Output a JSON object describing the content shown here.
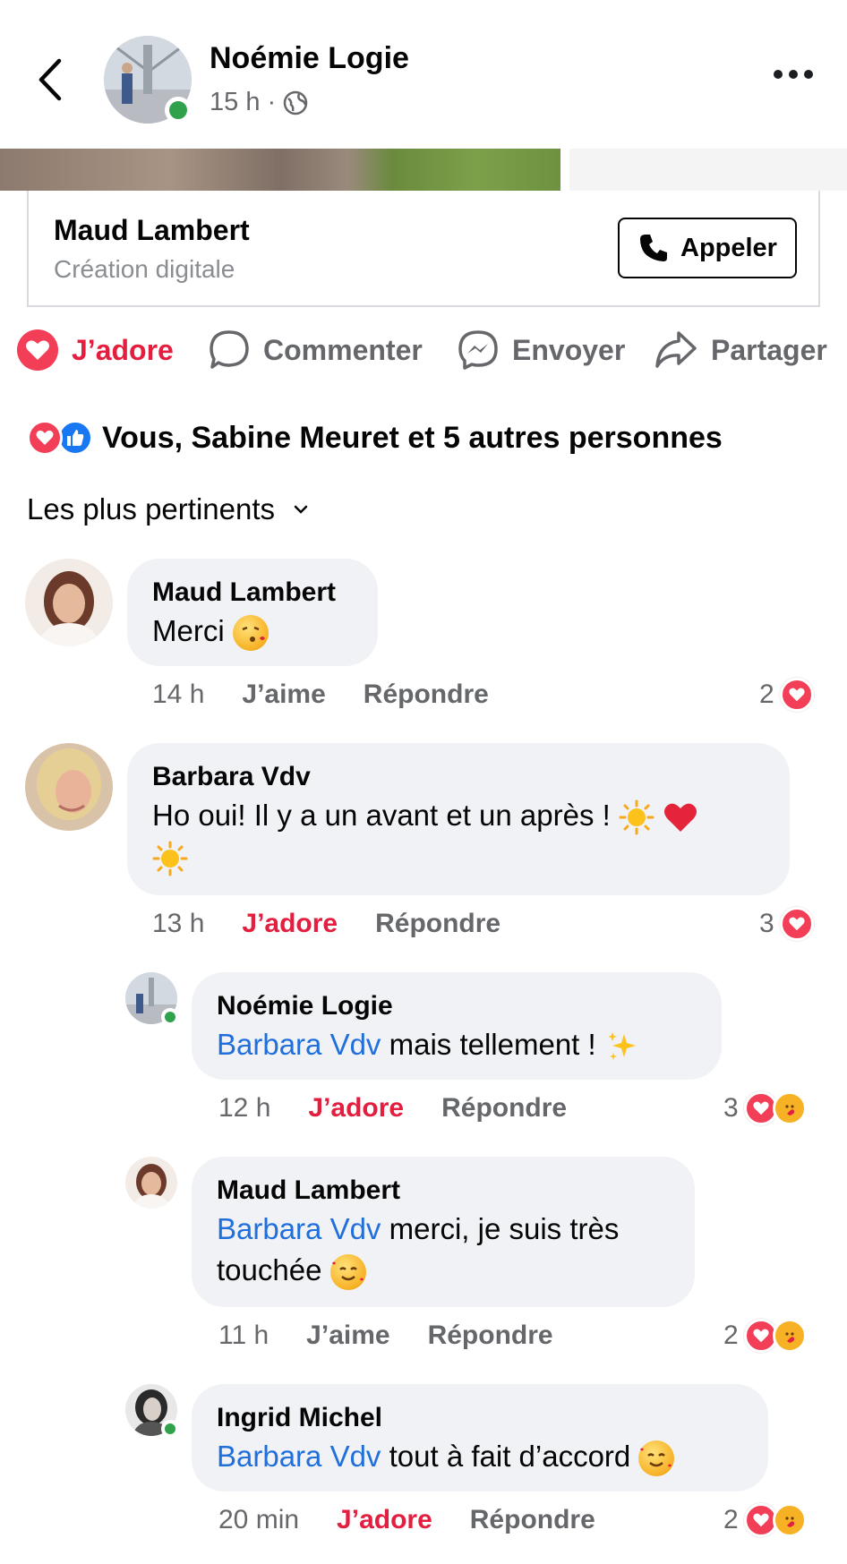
{
  "header": {
    "author": "Noémie Logie",
    "time": "15 h",
    "separator": "·",
    "icons": {
      "back": "chevron-left-icon",
      "privacy": "globe-icon",
      "more": "more-horizontal-icon"
    }
  },
  "business_card": {
    "name": "Maud Lambert",
    "subtitle": "Création digitale",
    "call_label": "Appeler",
    "call_icon": "phone-icon"
  },
  "actions": [
    {
      "label": "J’adore",
      "icon": "heart-icon",
      "active": true
    },
    {
      "label": "Commenter",
      "icon": "comment-icon",
      "active": false
    },
    {
      "label": "Envoyer",
      "icon": "messenger-icon",
      "active": false
    },
    {
      "label": "Partager",
      "icon": "share-icon",
      "active": false
    }
  ],
  "reactions_summary": {
    "text": "Vous, Sabine Meuret et 5 autres personnes",
    "icons": [
      "love-reaction-icon",
      "like-reaction-icon"
    ]
  },
  "sort": {
    "label": "Les plus pertinents",
    "icon": "chevron-down-icon"
  },
  "comments": [
    {
      "name": "Maud Lambert",
      "text": "Merci",
      "emoji": "kissing-face-icon",
      "time": "14 h",
      "like_label": "J’aime",
      "reply_label": "Répondre",
      "count": "2",
      "liked": false
    },
    {
      "name": "Barbara Vdv",
      "text": "Ho oui! Il y a un avant et un après !",
      "emoji": "sun-icon heart-icon sun-icon",
      "time": "13 h",
      "like_label": "J’adore",
      "reply_label": "Répondre",
      "count": "3",
      "liked": true
    },
    {
      "name": "Noémie Logie",
      "mention": "Barbara Vdv",
      "text": "mais tellement !",
      "emoji": "sparkles-icon",
      "time": "12 h",
      "like_label": "J’adore",
      "reply_label": "Répondre",
      "count": "3",
      "liked": true
    },
    {
      "name": "Maud Lambert",
      "mention": "Barbara Vdv",
      "text": "merci, je suis très",
      "text2": "touchée",
      "emoji": "smiling-face-with-hearts-icon",
      "time": "11 h",
      "like_label": "J’aime",
      "reply_label": "Répondre",
      "count": "2",
      "liked": false
    },
    {
      "name": "Ingrid Michel",
      "mention": "Barbara Vdv",
      "text": "tout à fait d’accord",
      "emoji": "smiling-face-with-hearts-icon",
      "time": "20 min",
      "like_label": "J’adore",
      "reply_label": "Répondre",
      "count": "2",
      "liked": true
    }
  ],
  "colors": {
    "accent_red": "#e41e3f",
    "mention_blue": "#216fdb",
    "bubble_bg": "#f0f2f5",
    "secondary_text": "#65676b",
    "online_green": "#31a24c"
  }
}
